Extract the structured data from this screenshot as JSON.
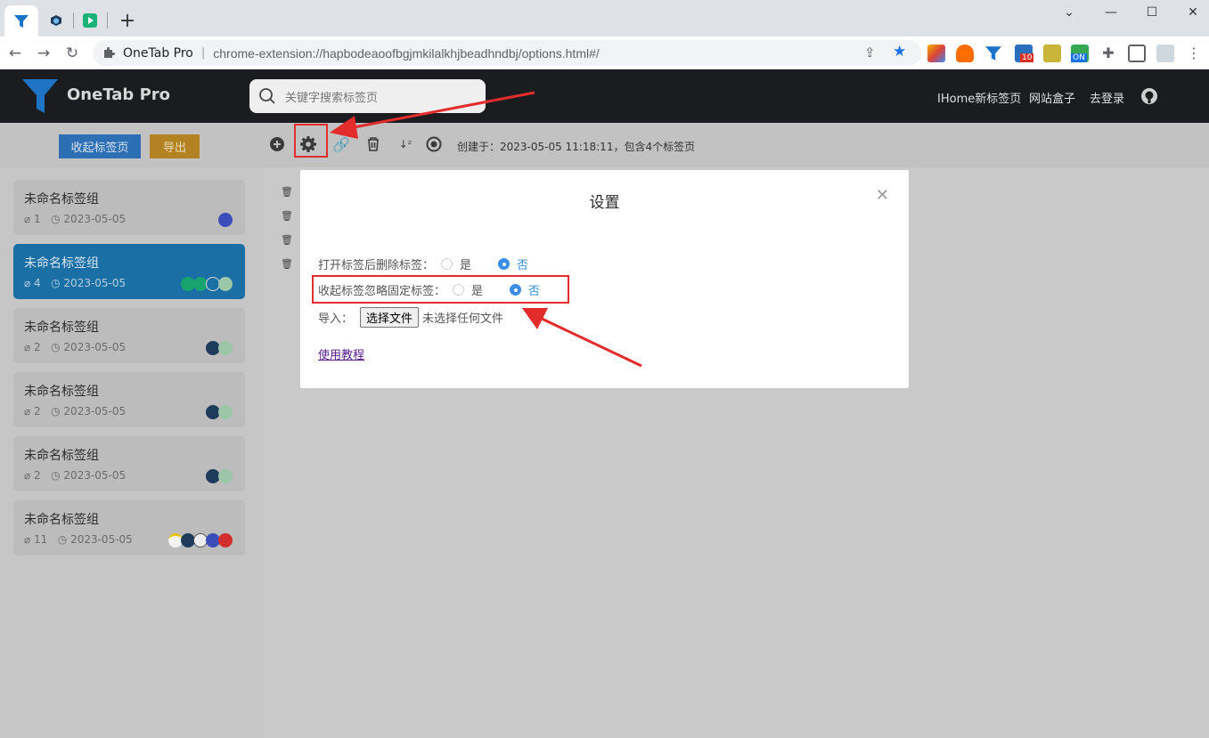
{
  "browser": {
    "site_name": "OneTab Pro",
    "url": "chrome-extension://hapbodeaoofbgjmkilalkhjbeadhndbj/options.html#/",
    "ext_badge_count": "10",
    "ext_badge_on": "ON"
  },
  "header": {
    "app_name": "OneTab Pro",
    "search_placeholder": "关键字搜索标签页",
    "links": [
      "IHome新标签页",
      "网站盒子",
      "去登录"
    ]
  },
  "actions": {
    "collapse_label": "收起标签页",
    "export_label": "导出",
    "created_info": "创建于：2023-05-05 11:18:11，包含4个标签页"
  },
  "groups": [
    {
      "name": "未命名标签组",
      "count": "1",
      "date": "2023-05-05"
    },
    {
      "name": "未命名标签组",
      "count": "4",
      "date": "2023-05-05"
    },
    {
      "name": "未命名标签组",
      "count": "2",
      "date": "2023-05-05"
    },
    {
      "name": "未命名标签组",
      "count": "2",
      "date": "2023-05-05"
    },
    {
      "name": "未命名标签组",
      "count": "2",
      "date": "2023-05-05"
    },
    {
      "name": "未命名标签组",
      "count": "11",
      "date": "2023-05-05"
    }
  ],
  "settings": {
    "title": "设置",
    "delete_after_open_label": "打开标签后删除标签：",
    "ignore_pinned_label": "收起标签忽略固定标签：",
    "yes": "是",
    "no": "否",
    "import_label": "导入：",
    "choose_file": "选择文件",
    "no_file": "未选择任何文件",
    "tutorial": "使用教程"
  },
  "colors": {
    "accent": "#3a8ee6",
    "header_bg": "#1a1c1f",
    "active_group": "#1a6fa5",
    "annotation_red": "#e32c2c"
  }
}
